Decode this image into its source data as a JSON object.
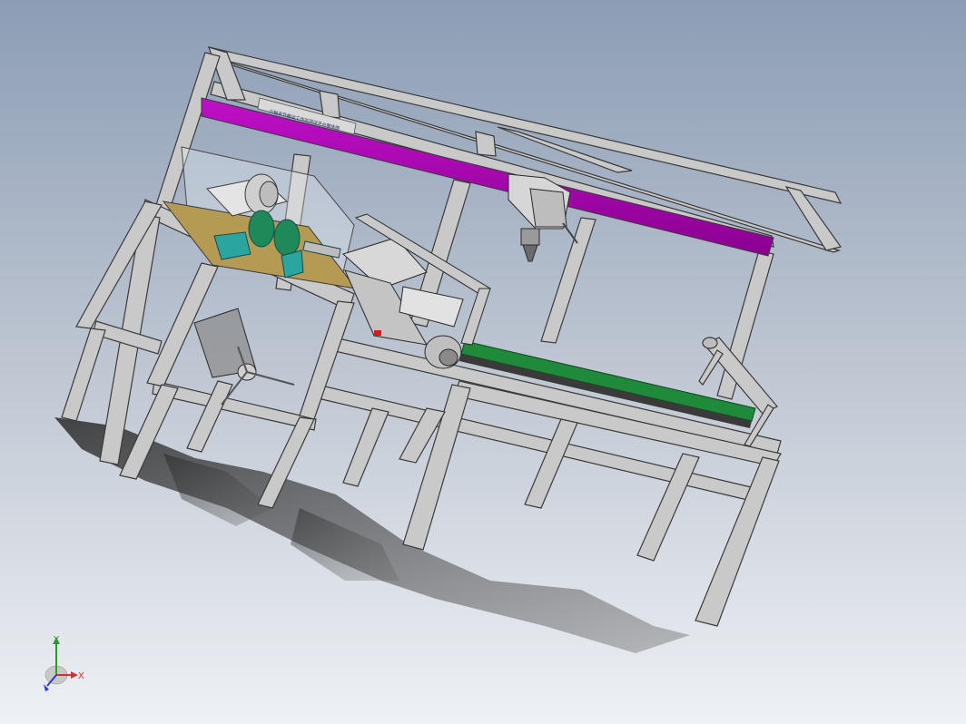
{
  "scene": {
    "background_top": "#8c9db5",
    "background_bottom": "#eef1f5",
    "frame_color": "#c9c9c9",
    "frame_edge": "#3a3a3a",
    "beam_color": "#a000a8",
    "conveyor_color": "#1e8a3a",
    "base_plate_color": "#b49a52",
    "motor_color": "#dcdcdc",
    "fixture_color": "#2aa5a0",
    "sign_text": "六轴关节搬运工作站测试平台整体图"
  },
  "triad": {
    "x_label": "X",
    "y_label": "Y",
    "x_color": "#d43030",
    "y_color": "#2a9a2a",
    "z_color": "#2a3ad4"
  }
}
